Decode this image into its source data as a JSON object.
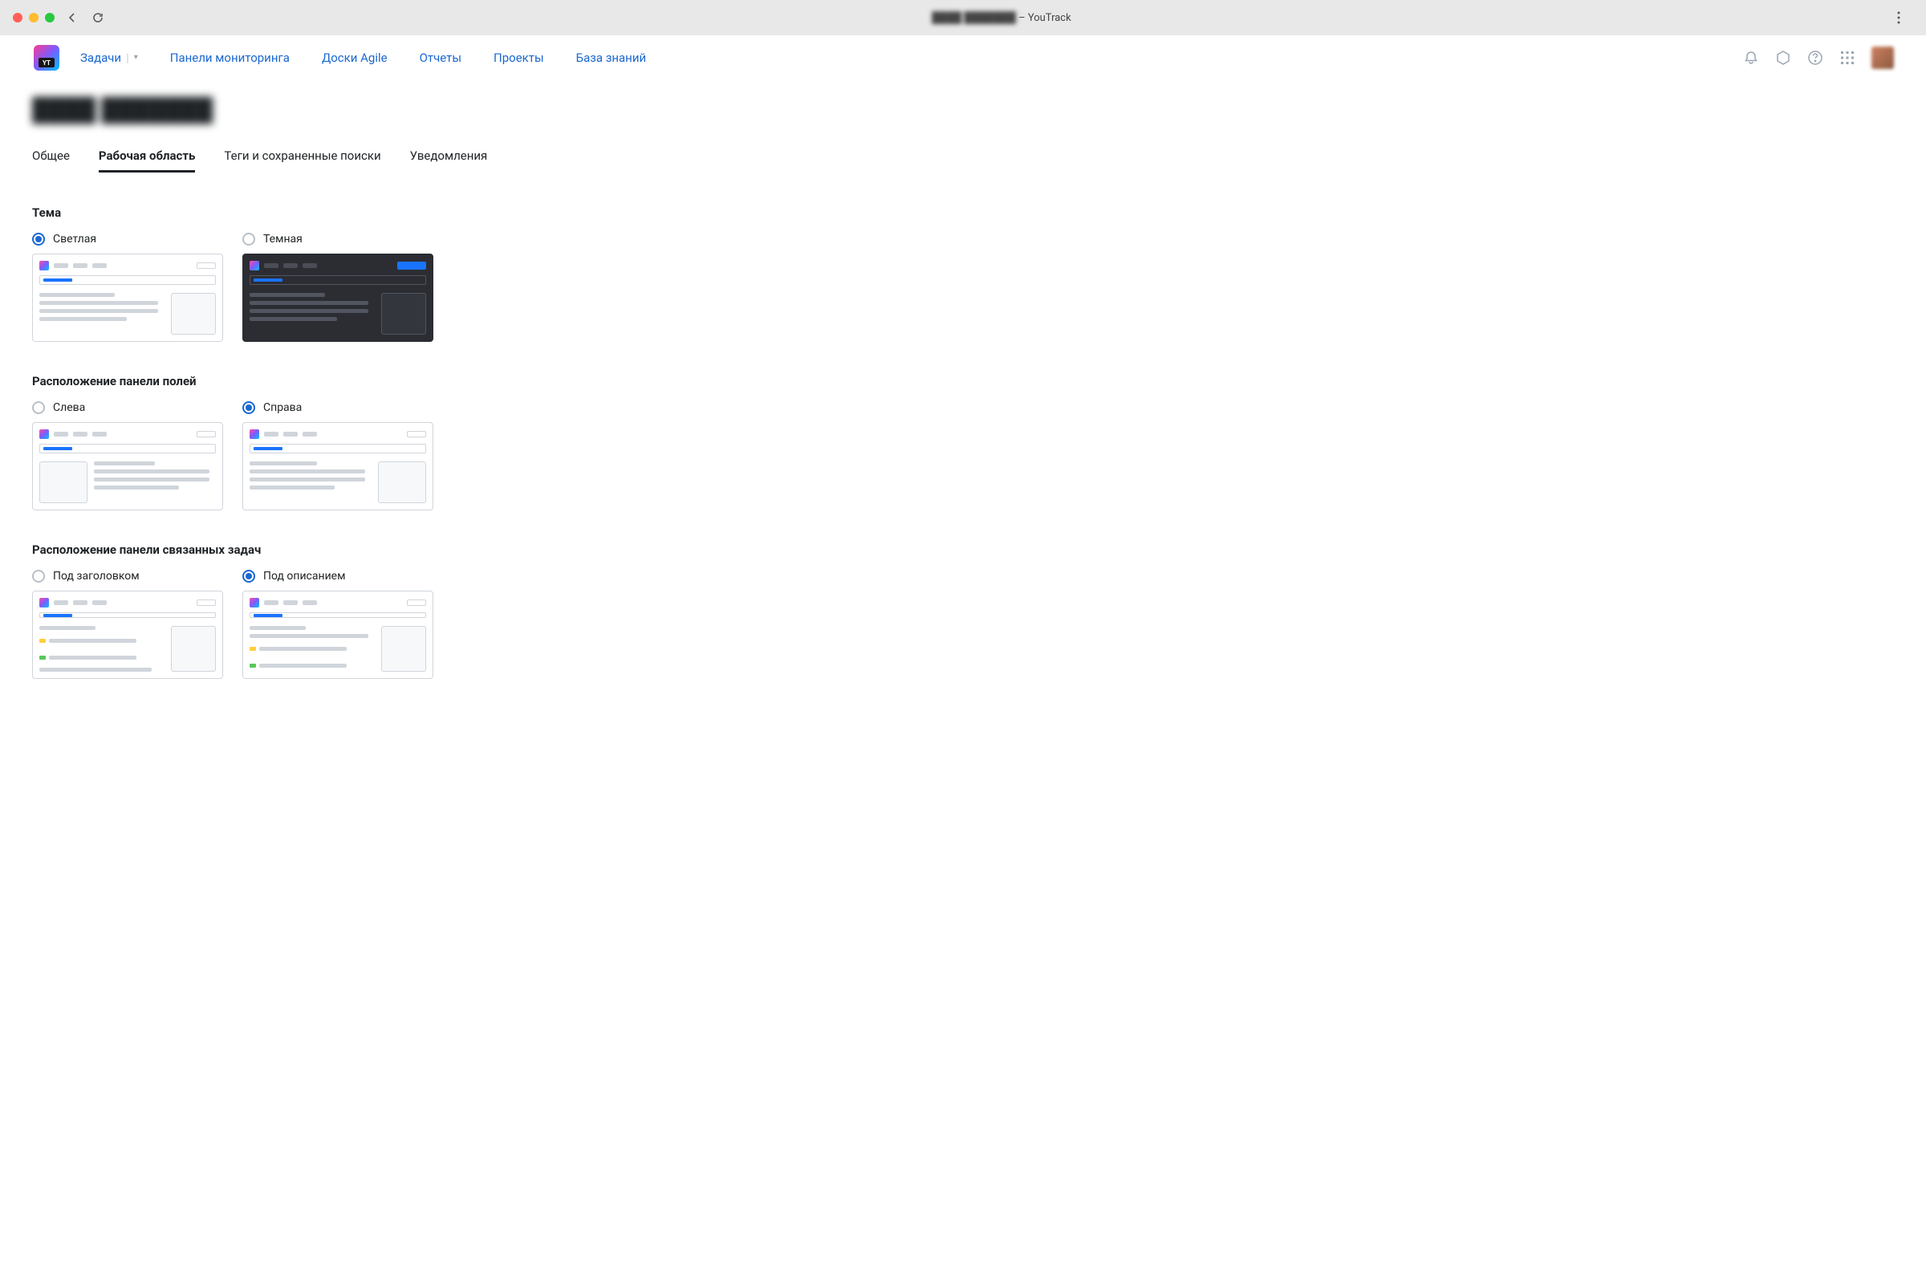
{
  "browser": {
    "title_blurred": "████ ███████",
    "title_suffix": " – YouTrack"
  },
  "nav": {
    "issues": "Задачи",
    "dashboards": "Панели мониторинга",
    "agile": "Доски Agile",
    "reports": "Отчеты",
    "projects": "Проекты",
    "knowledge": "База знаний"
  },
  "page": {
    "title": "████ ███████"
  },
  "tabs": {
    "general": "Общее",
    "workspace": "Рабочая область",
    "tags": "Теги и сохраненные поиски",
    "notifications": "Уведомления"
  },
  "theme": {
    "title": "Тема",
    "light": "Светлая",
    "dark": "Темная",
    "selected": "light"
  },
  "fields_panel": {
    "title": "Расположение панели полей",
    "left": "Слева",
    "right": "Справа",
    "selected": "right"
  },
  "linked_panel": {
    "title": "Расположение панели связанных задач",
    "under_title": "Под заголовком",
    "under_desc": "Под описанием",
    "selected": "under_desc"
  }
}
